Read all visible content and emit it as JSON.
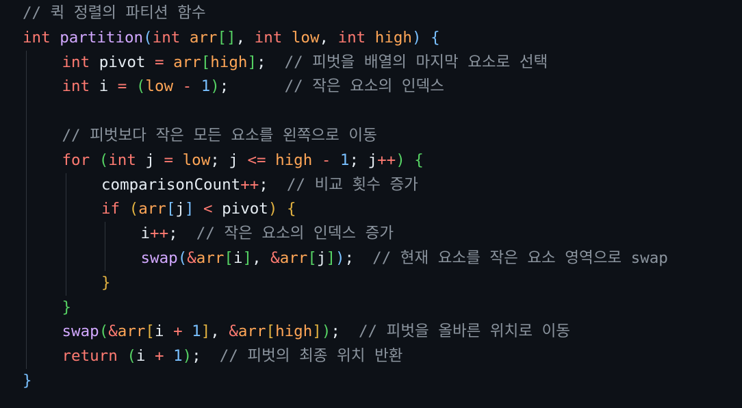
{
  "editor": {
    "language": "c",
    "colors": {
      "background": "#0d1117",
      "keyword": "#ff7b72",
      "function": "#d2a8ff",
      "plain": "#e6edf3",
      "parameter": "#ffa657",
      "number": "#79c0ff",
      "comment": "#8b949e",
      "bracket_level_1": "#79c0ff",
      "bracket_level_2": "#56d364",
      "bracket_level_3": "#e3b341",
      "indent_guide": "#30363d"
    },
    "lines": [
      {
        "indent": 0,
        "tokens": [
          {
            "t": "// 퀵 정렬의 파티션 함수",
            "c": "comment"
          }
        ]
      },
      {
        "indent": 0,
        "tokens": [
          {
            "t": "int",
            "c": "keyword"
          },
          {
            "t": " ",
            "c": "plain"
          },
          {
            "t": "partition",
            "c": "func"
          },
          {
            "t": "(",
            "c": "b1"
          },
          {
            "t": "int",
            "c": "keyword"
          },
          {
            "t": " ",
            "c": "plain"
          },
          {
            "t": "arr",
            "c": "param"
          },
          {
            "t": "[]",
            "c": "b2"
          },
          {
            "t": ", ",
            "c": "punc"
          },
          {
            "t": "int",
            "c": "keyword"
          },
          {
            "t": " ",
            "c": "plain"
          },
          {
            "t": "low",
            "c": "param"
          },
          {
            "t": ", ",
            "c": "punc"
          },
          {
            "t": "int",
            "c": "keyword"
          },
          {
            "t": " ",
            "c": "plain"
          },
          {
            "t": "high",
            "c": "param"
          },
          {
            "t": ")",
            "c": "b1"
          },
          {
            "t": " ",
            "c": "plain"
          },
          {
            "t": "{",
            "c": "b1"
          }
        ]
      },
      {
        "indent": 1,
        "tokens": [
          {
            "t": "int",
            "c": "keyword"
          },
          {
            "t": " ",
            "c": "plain"
          },
          {
            "t": "pivot",
            "c": "plain"
          },
          {
            "t": " ",
            "c": "plain"
          },
          {
            "t": "=",
            "c": "op"
          },
          {
            "t": " ",
            "c": "plain"
          },
          {
            "t": "arr",
            "c": "param"
          },
          {
            "t": "[",
            "c": "b2"
          },
          {
            "t": "high",
            "c": "param"
          },
          {
            "t": "]",
            "c": "b2"
          },
          {
            "t": ";",
            "c": "punc"
          },
          {
            "t": "  // 피벗을 배열의 마지막 요소로 선택",
            "c": "comment"
          }
        ]
      },
      {
        "indent": 1,
        "tokens": [
          {
            "t": "int",
            "c": "keyword"
          },
          {
            "t": " ",
            "c": "plain"
          },
          {
            "t": "i",
            "c": "plain"
          },
          {
            "t": " ",
            "c": "plain"
          },
          {
            "t": "=",
            "c": "op"
          },
          {
            "t": " ",
            "c": "plain"
          },
          {
            "t": "(",
            "c": "b2"
          },
          {
            "t": "low",
            "c": "param"
          },
          {
            "t": " ",
            "c": "plain"
          },
          {
            "t": "-",
            "c": "op"
          },
          {
            "t": " ",
            "c": "plain"
          },
          {
            "t": "1",
            "c": "number"
          },
          {
            "t": ")",
            "c": "b2"
          },
          {
            "t": ";",
            "c": "punc"
          },
          {
            "t": "      // 작은 요소의 인덱스",
            "c": "comment"
          }
        ]
      },
      {
        "indent": 1,
        "tokens": []
      },
      {
        "indent": 1,
        "tokens": [
          {
            "t": "// 피벗보다 작은 모든 요소를 왼쪽으로 이동",
            "c": "comment"
          }
        ]
      },
      {
        "indent": 1,
        "tokens": [
          {
            "t": "for",
            "c": "keyword"
          },
          {
            "t": " ",
            "c": "plain"
          },
          {
            "t": "(",
            "c": "b2"
          },
          {
            "t": "int",
            "c": "keyword"
          },
          {
            "t": " ",
            "c": "plain"
          },
          {
            "t": "j",
            "c": "plain"
          },
          {
            "t": " ",
            "c": "plain"
          },
          {
            "t": "=",
            "c": "op"
          },
          {
            "t": " ",
            "c": "plain"
          },
          {
            "t": "low",
            "c": "param"
          },
          {
            "t": "; ",
            "c": "punc"
          },
          {
            "t": "j",
            "c": "plain"
          },
          {
            "t": " ",
            "c": "plain"
          },
          {
            "t": "<=",
            "c": "op"
          },
          {
            "t": " ",
            "c": "plain"
          },
          {
            "t": "high",
            "c": "param"
          },
          {
            "t": " ",
            "c": "plain"
          },
          {
            "t": "-",
            "c": "op"
          },
          {
            "t": " ",
            "c": "plain"
          },
          {
            "t": "1",
            "c": "number"
          },
          {
            "t": "; ",
            "c": "punc"
          },
          {
            "t": "j",
            "c": "plain"
          },
          {
            "t": "++",
            "c": "op"
          },
          {
            "t": ")",
            "c": "b2"
          },
          {
            "t": " ",
            "c": "plain"
          },
          {
            "t": "{",
            "c": "b2"
          }
        ]
      },
      {
        "indent": 2,
        "tokens": [
          {
            "t": "comparisonCount",
            "c": "plain"
          },
          {
            "t": "++",
            "c": "op"
          },
          {
            "t": ";",
            "c": "punc"
          },
          {
            "t": "  // 비교 횟수 증가",
            "c": "comment"
          }
        ]
      },
      {
        "indent": 2,
        "tokens": [
          {
            "t": "if",
            "c": "keyword"
          },
          {
            "t": " ",
            "c": "plain"
          },
          {
            "t": "(",
            "c": "b3"
          },
          {
            "t": "arr",
            "c": "param"
          },
          {
            "t": "[",
            "c": "b1"
          },
          {
            "t": "j",
            "c": "plain"
          },
          {
            "t": "]",
            "c": "b1"
          },
          {
            "t": " ",
            "c": "plain"
          },
          {
            "t": "<",
            "c": "op"
          },
          {
            "t": " ",
            "c": "plain"
          },
          {
            "t": "pivot",
            "c": "plain"
          },
          {
            "t": ")",
            "c": "b3"
          },
          {
            "t": " ",
            "c": "plain"
          },
          {
            "t": "{",
            "c": "b3"
          }
        ]
      },
      {
        "indent": 3,
        "tokens": [
          {
            "t": "i",
            "c": "plain"
          },
          {
            "t": "++",
            "c": "op"
          },
          {
            "t": ";",
            "c": "punc"
          },
          {
            "t": "  // 작은 요소의 인덱스 증가",
            "c": "comment"
          }
        ]
      },
      {
        "indent": 3,
        "tokens": [
          {
            "t": "swap",
            "c": "func"
          },
          {
            "t": "(",
            "c": "b1"
          },
          {
            "t": "&",
            "c": "op"
          },
          {
            "t": "arr",
            "c": "param"
          },
          {
            "t": "[",
            "c": "b2"
          },
          {
            "t": "i",
            "c": "plain"
          },
          {
            "t": "]",
            "c": "b2"
          },
          {
            "t": ", ",
            "c": "punc"
          },
          {
            "t": "&",
            "c": "op"
          },
          {
            "t": "arr",
            "c": "param"
          },
          {
            "t": "[",
            "c": "b2"
          },
          {
            "t": "j",
            "c": "plain"
          },
          {
            "t": "]",
            "c": "b2"
          },
          {
            "t": ")",
            "c": "b1"
          },
          {
            "t": ";",
            "c": "punc"
          },
          {
            "t": "  // 현재 요소를 작은 요소 영역으로 swap",
            "c": "comment"
          }
        ]
      },
      {
        "indent": 2,
        "tokens": [
          {
            "t": "}",
            "c": "b3"
          }
        ]
      },
      {
        "indent": 1,
        "tokens": [
          {
            "t": "}",
            "c": "b2"
          }
        ]
      },
      {
        "indent": 1,
        "tokens": [
          {
            "t": "swap",
            "c": "func"
          },
          {
            "t": "(",
            "c": "b2"
          },
          {
            "t": "&",
            "c": "op"
          },
          {
            "t": "arr",
            "c": "param"
          },
          {
            "t": "[",
            "c": "b3"
          },
          {
            "t": "i",
            "c": "plain"
          },
          {
            "t": " ",
            "c": "plain"
          },
          {
            "t": "+",
            "c": "op"
          },
          {
            "t": " ",
            "c": "plain"
          },
          {
            "t": "1",
            "c": "number"
          },
          {
            "t": "]",
            "c": "b3"
          },
          {
            "t": ", ",
            "c": "punc"
          },
          {
            "t": "&",
            "c": "op"
          },
          {
            "t": "arr",
            "c": "param"
          },
          {
            "t": "[",
            "c": "b3"
          },
          {
            "t": "high",
            "c": "param"
          },
          {
            "t": "]",
            "c": "b3"
          },
          {
            "t": ")",
            "c": "b2"
          },
          {
            "t": ";",
            "c": "punc"
          },
          {
            "t": "  // 피벗을 올바른 위치로 이동",
            "c": "comment"
          }
        ]
      },
      {
        "indent": 1,
        "tokens": [
          {
            "t": "return",
            "c": "keyword"
          },
          {
            "t": " ",
            "c": "plain"
          },
          {
            "t": "(",
            "c": "b2"
          },
          {
            "t": "i",
            "c": "plain"
          },
          {
            "t": " ",
            "c": "plain"
          },
          {
            "t": "+",
            "c": "op"
          },
          {
            "t": " ",
            "c": "plain"
          },
          {
            "t": "1",
            "c": "number"
          },
          {
            "t": ")",
            "c": "b2"
          },
          {
            "t": ";",
            "c": "punc"
          },
          {
            "t": "  // 피벗의 최종 위치 반환",
            "c": "comment"
          }
        ]
      },
      {
        "indent": 0,
        "tokens": [
          {
            "t": "}",
            "c": "b1"
          }
        ]
      }
    ]
  }
}
